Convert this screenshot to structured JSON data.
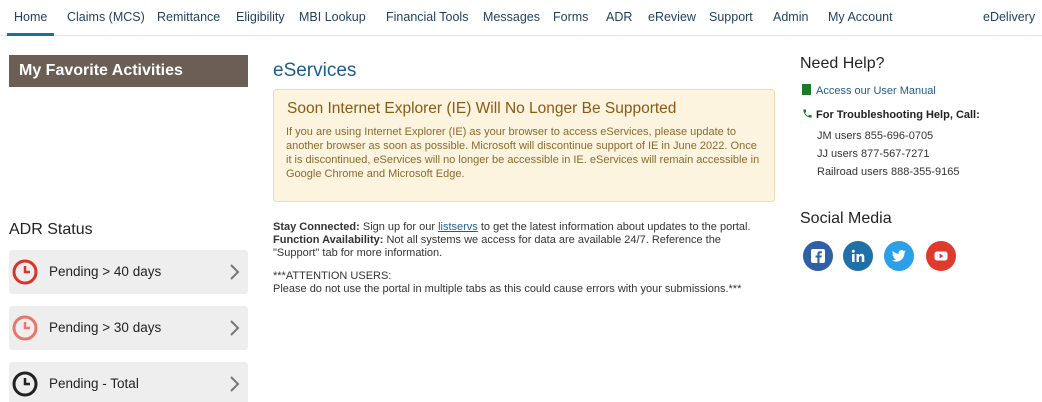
{
  "nav": {
    "items": [
      {
        "label": "Home"
      },
      {
        "label": "Claims (MCS)"
      },
      {
        "label": "Remittance"
      },
      {
        "label": "Eligibility"
      },
      {
        "label": "MBI Lookup"
      },
      {
        "label": "Financial Tools"
      },
      {
        "label": "Messages"
      },
      {
        "label": "Forms"
      },
      {
        "label": "ADR"
      },
      {
        "label": "eReview"
      },
      {
        "label": "Support"
      },
      {
        "label": "Admin"
      },
      {
        "label": "My Account"
      }
    ],
    "right_item": "eDelivery",
    "active_index": 0
  },
  "left": {
    "favorites_title": "My Favorite Activities",
    "adr_title": "ADR Status",
    "adr_items": [
      {
        "label": "Pending > 40 days",
        "icon": "clock-icon",
        "color": "#d9342b"
      },
      {
        "label": "Pending > 30 days",
        "icon": "clock-icon",
        "color": "#e8766b"
      },
      {
        "label": "Pending - Total",
        "icon": "clock-icon",
        "color": "#222222"
      }
    ]
  },
  "main": {
    "title": "eServices",
    "notice": {
      "title": "Soon Internet Explorer (IE) Will No Longer Be Supported",
      "body": "If you are using Internet Explorer (IE) as your browser to access eServices, please update to another browser as soon as possible. Microsoft will discontinue support of IE in June 2022. Once it is discontinued, eServices will no longer be accessible in IE. eServices will remain accessible in Google Chrome and Microsoft Edge."
    },
    "stay_connected_label": "Stay Connected:",
    "stay_connected_pre": " Sign up for our ",
    "listservs_link": "listservs",
    "stay_connected_post": " to get the latest information about updates to the portal.",
    "function_label": "Function Availability:",
    "function_text": " Not all systems we access for data are available 24/7. Reference the \"Support\" tab for more information.",
    "attention_title": "***ATTENTION USERS:",
    "attention_text": "Please do not use the portal in multiple tabs as this could cause errors with your submissions.***"
  },
  "right": {
    "help_title": "Need Help?",
    "manual_link": "Access our User Manual",
    "trouble_label": "For Troubleshooting Help, Call:",
    "phones": [
      "JM users 855-696-0705",
      "JJ users 877-567-7271",
      "Railroad users 888-355-9165"
    ],
    "social_title": "Social Media",
    "social": [
      {
        "name": "facebook-icon",
        "color": "#2f5fa6"
      },
      {
        "name": "linkedin-icon",
        "color": "#1f6fa8"
      },
      {
        "name": "twitter-icon",
        "color": "#2ba0e8"
      },
      {
        "name": "youtube-icon",
        "color": "#e03a2f"
      }
    ]
  }
}
